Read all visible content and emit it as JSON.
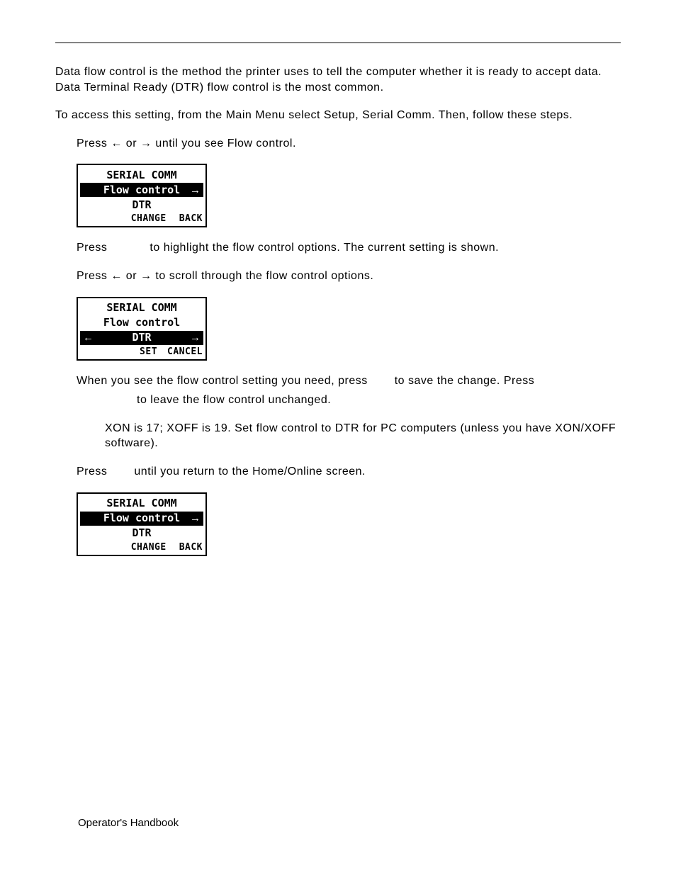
{
  "intro1": "Data flow control is the method the printer uses to tell the computer whether it is ready to accept data. Data Terminal Ready (DTR) flow control is the most common.",
  "intro2": "To access this setting, from the Main Menu select Setup, Serial Comm.  Then, follow these steps.",
  "step1_a": "Press ",
  "step1_b": " or ",
  "step1_c": " until you see Flow control.",
  "arrow_left": "←",
  "arrow_right": "→",
  "lcd": {
    "title": "SERIAL COMM",
    "item": "Flow control",
    "value": "DTR",
    "change": "CHANGE",
    "back": "BACK",
    "set": "SET",
    "cancel": "CANCEL"
  },
  "step2_a": "Press",
  "step2_b": "to highlight the flow control options. The current setting is shown.",
  "step3_a": "Press ",
  "step3_b": " or ",
  "step3_c": " to scroll through the flow control options.",
  "step4_a": "When you see the flow control setting you need, press",
  "step4_b": "to save the change.  Press",
  "step4_c": "to leave the flow control unchanged.",
  "note": "XON is 17; XOFF is 19.  Set flow control to DTR for PC computers (unless you have XON/XOFF software).",
  "step5_a": "Press",
  "step5_b": "until you return to the Home/Online screen.",
  "footer": "Operator's Handbook"
}
